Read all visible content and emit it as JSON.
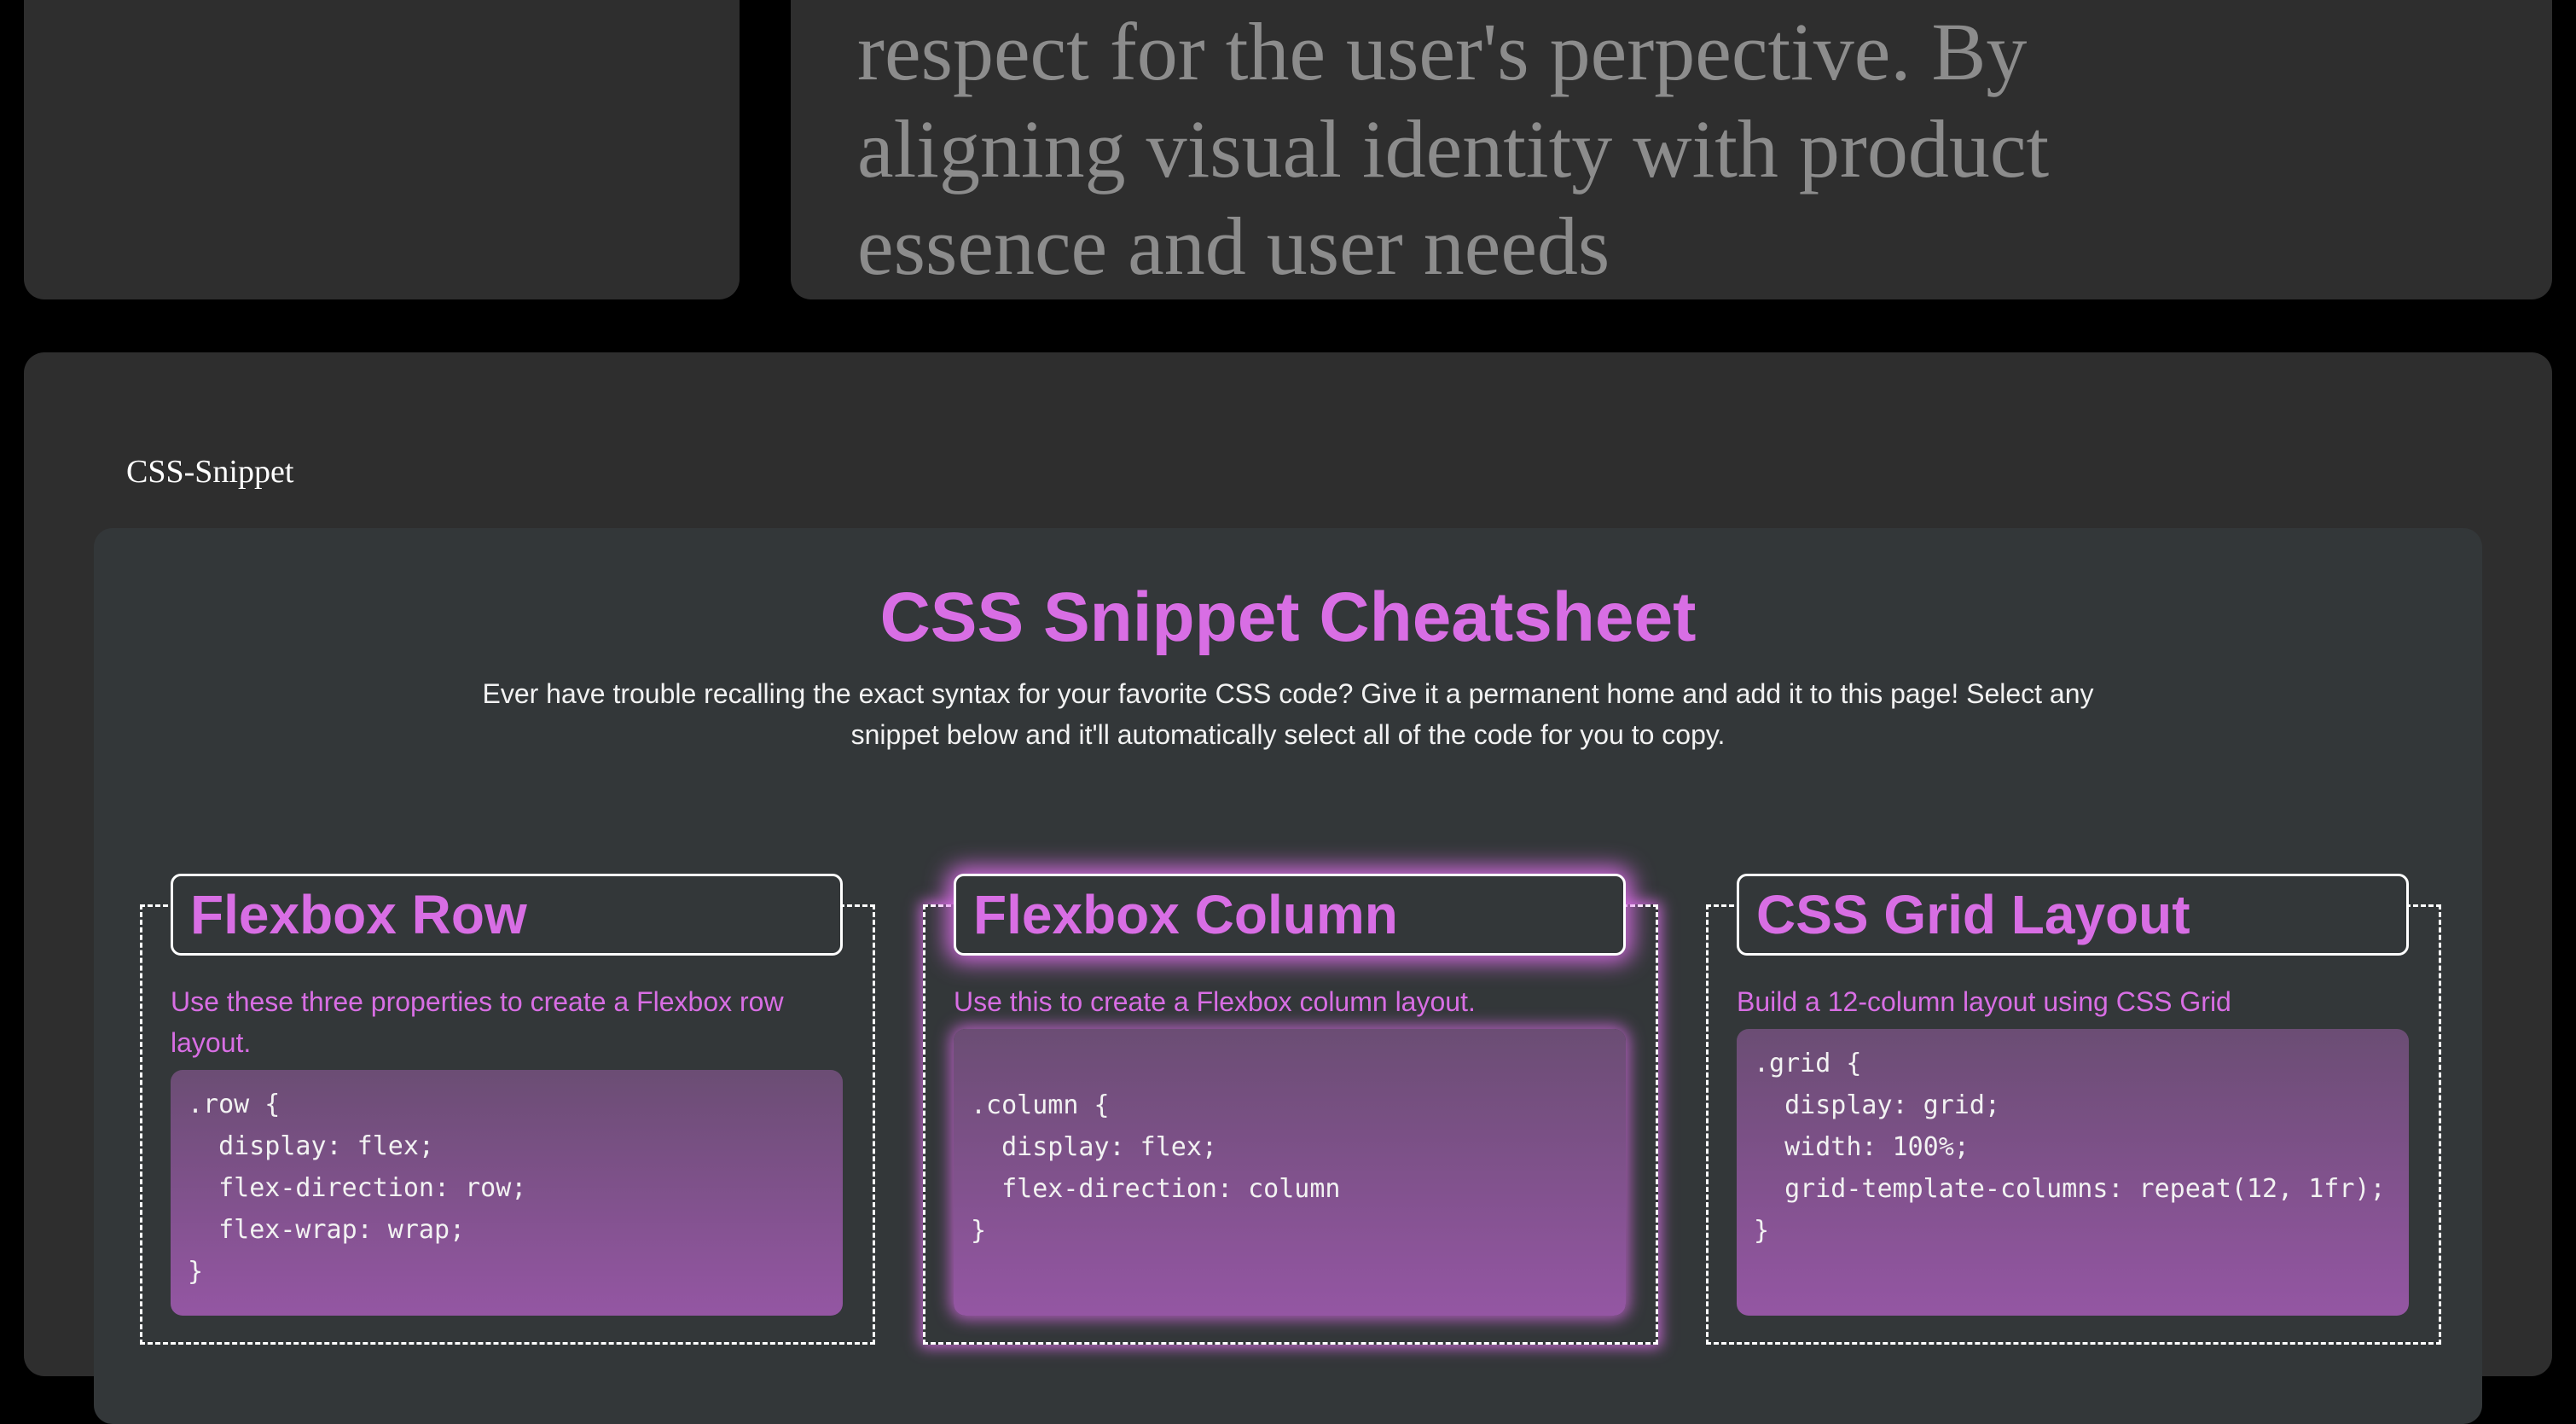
{
  "quote": {
    "text": "respect for the user's perpective. By\naligning visual identity with product\nessence and user needs"
  },
  "snippet_section": {
    "label": "CSS-Snippet",
    "title": "CSS Snippet Cheatsheet",
    "intro": "Ever have trouble recalling the exact syntax for your favorite CSS code? Give it a permanent home and add it to this page! Select any snippet below and it'll automatically select all of the code for you to copy.",
    "accent_color": "#d86ee4",
    "cards": [
      {
        "title": "Flexbox Row",
        "description": "Use these three properties to create a Flexbox row layout.",
        "code": ".row {\n  display: flex;\n  flex-direction: row;\n  flex-wrap: wrap;\n}"
      },
      {
        "title": "Flexbox Column",
        "description": "Use this to create a Flexbox column layout.",
        "code": "\n.column {\n  display: flex;\n  flex-direction: column\n}\n"
      },
      {
        "title": "CSS Grid Layout",
        "description": "Build a 12-column layout using CSS Grid",
        "code": ".grid {\n  display: grid;\n  width: 100%;\n  grid-template-columns: repeat(12, 1fr);\n}"
      }
    ]
  }
}
